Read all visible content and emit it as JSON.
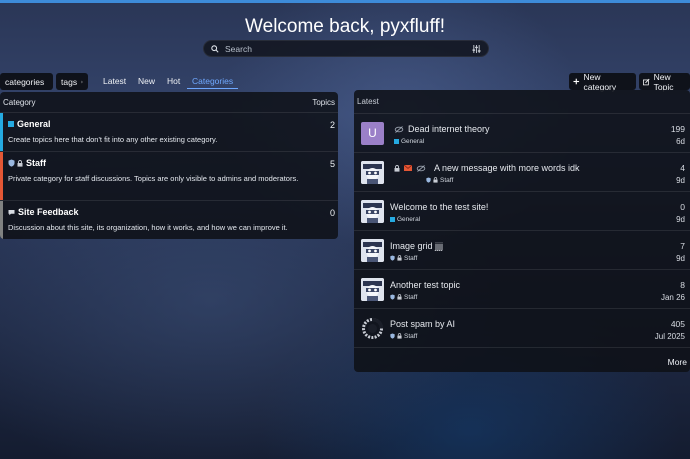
{
  "header": {
    "welcome": "Welcome back, pyxfluff!",
    "search_placeholder": "Search"
  },
  "nav": {
    "categories_dropdown": "categories",
    "tags_dropdown": "tags",
    "links": [
      "Latest",
      "New",
      "Hot",
      "Categories"
    ],
    "active": "Categories",
    "new_category": "New category",
    "new_topic": "New Topic"
  },
  "categories": {
    "header_category": "Category",
    "header_topics": "Topics",
    "items": [
      {
        "name": "General",
        "count": "2",
        "description": "Create topics here that don't fit into any other existing category.",
        "color": "#25aae1"
      },
      {
        "name": "Staff",
        "count": "5",
        "description": "Private category for staff discussions. Topics are only visible to admins and moderators.",
        "color": "#e45735"
      },
      {
        "name": "Site Feedback",
        "count": "0",
        "description": "Discussion about this site, its organization, how it works, and how we can improve it.",
        "color": "#808281"
      }
    ]
  },
  "latest": {
    "header": "Latest",
    "more": "More",
    "topics": [
      {
        "title": "Dead internet theory",
        "category": "General",
        "replies": "199",
        "age": "6d",
        "avatar_letter": "U"
      },
      {
        "title": "A new message with more words idk",
        "category": "Staff",
        "replies": "4",
        "age": "9d"
      },
      {
        "title": "Welcome to the test site!",
        "category": "General",
        "replies": "0",
        "age": "9d"
      },
      {
        "title": "Image grid jjjj",
        "category": "Staff",
        "replies": "7",
        "age": "9d"
      },
      {
        "title": "Another test topic",
        "category": "Staff",
        "replies": "8",
        "age": "Jan 26"
      },
      {
        "title": "Post spam by AI",
        "category": "Staff",
        "replies": "405",
        "age": "Jul 2025"
      }
    ]
  },
  "colors": {
    "accent": "#6fa8ff",
    "general": "#25aae1",
    "staff": "#e45735",
    "feedback": "#808281",
    "avatar_u": "#9b80c8"
  },
  "icons": [
    "search-icon",
    "sliders-icon",
    "chevron-right-icon",
    "plus-icon",
    "edit-icon",
    "shield-icon",
    "lock-icon",
    "eye-slash-icon",
    "envelope-icon",
    "speech-bubble-icon"
  ]
}
